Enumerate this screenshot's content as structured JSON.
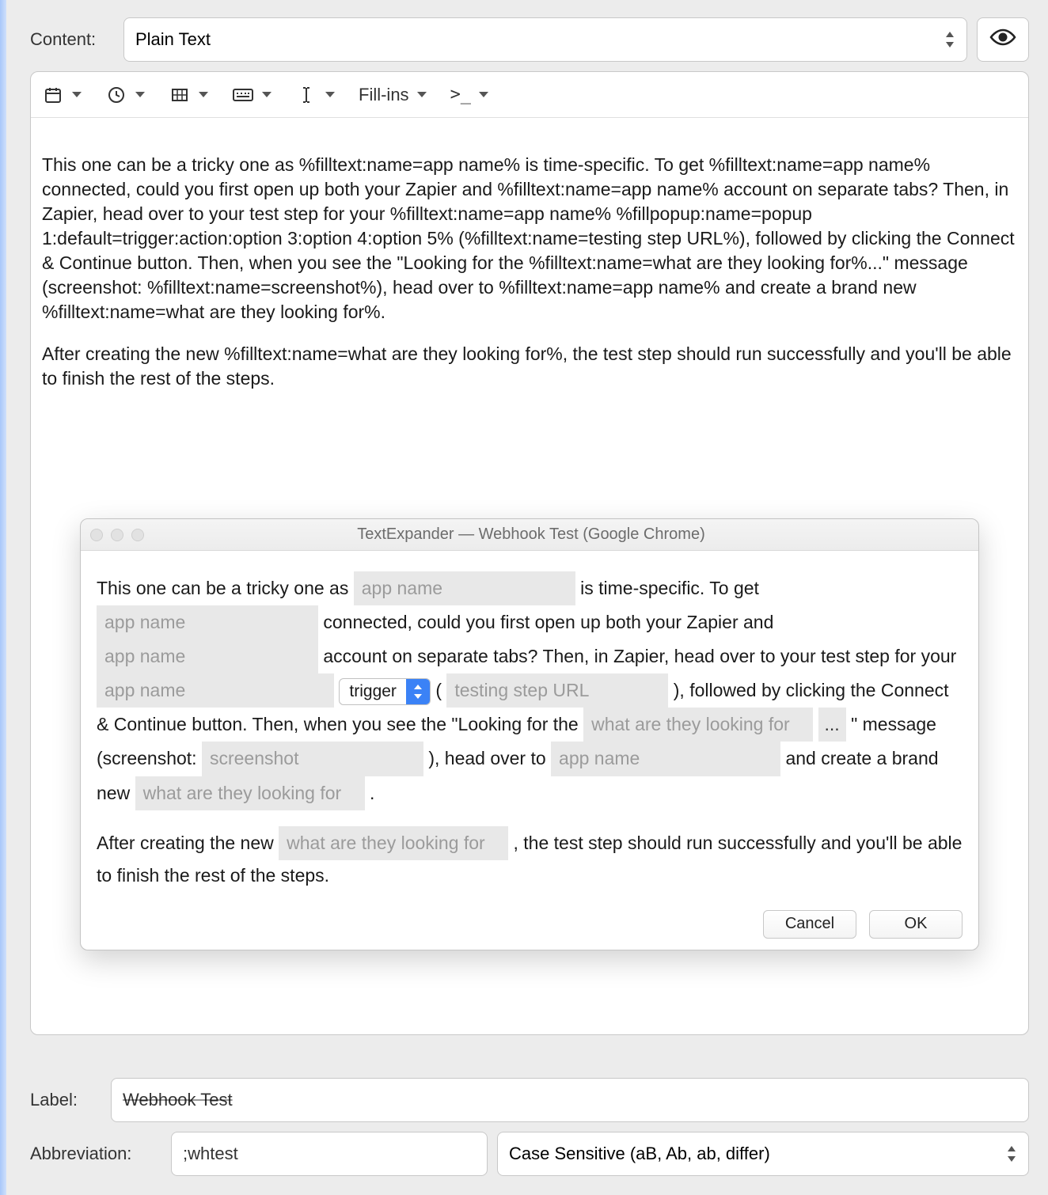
{
  "header": {
    "content_label": "Content:",
    "content_type": "Plain Text"
  },
  "toolbar": {
    "fillins_label": "Fill-ins",
    "script_label": ">_"
  },
  "snippet": {
    "para1": "This one can be a tricky one as %filltext:name=app name% is time-specific. To get %filltext:name=app name% connected, could you first open up both your Zapier and %filltext:name=app name% account on separate tabs? Then, in Zapier, head over to your test step for your %filltext:name=app name% %fillpopup:name=popup 1:default=trigger:action:option 3:option 4:option 5% (%filltext:name=testing step URL%), followed by clicking the Connect & Continue button. Then, when you see the \"Looking for the %filltext:name=what are they looking for%...\" message (screenshot: %filltext:name=screenshot%), head over to %filltext:name=app name% and create a brand new %filltext:name=what are they looking for%.",
    "para2": "After creating the new %filltext:name=what are they looking for%, the test step should run successfully and you'll be able to finish the rest of the steps."
  },
  "dialog": {
    "title": "TextExpander — Webhook Test (Google Chrome)",
    "text": {
      "t1": "This one can be a tricky one as ",
      "t2": " is time-specific. To get ",
      "t3": " connected, could you first open up both your Zapier and ",
      "t4": " account on separate tabs? Then, in Zapier, head over to your test step for your ",
      "t5_open": " ( ",
      "t5_close": " ), followed by clicking the Connect & Continue button. Then, when you see the \"Looking for the ",
      "t6": "\" message (screenshot: ",
      "t7": " ), head over to ",
      "t8": " and create a brand new ",
      "t9": " .",
      "p2a": "After creating the new ",
      "p2b": " , the test step should run successfully and you'll be able to finish the rest of the steps."
    },
    "fills": {
      "app_name": "app name",
      "testing_url": "testing step URL",
      "looking_for": "what are they looking for",
      "screenshot": "screenshot",
      "ellipsis": "..."
    },
    "popup": {
      "selected": "trigger"
    },
    "buttons": {
      "cancel": "Cancel",
      "ok": "OK"
    }
  },
  "footer": {
    "label_label": "Label:",
    "label_value": "Webhook Test",
    "abbrev_label": "Abbreviation:",
    "abbrev_value": ";whtest",
    "case_value": "Case Sensitive (aB, Ab, ab, differ)"
  }
}
